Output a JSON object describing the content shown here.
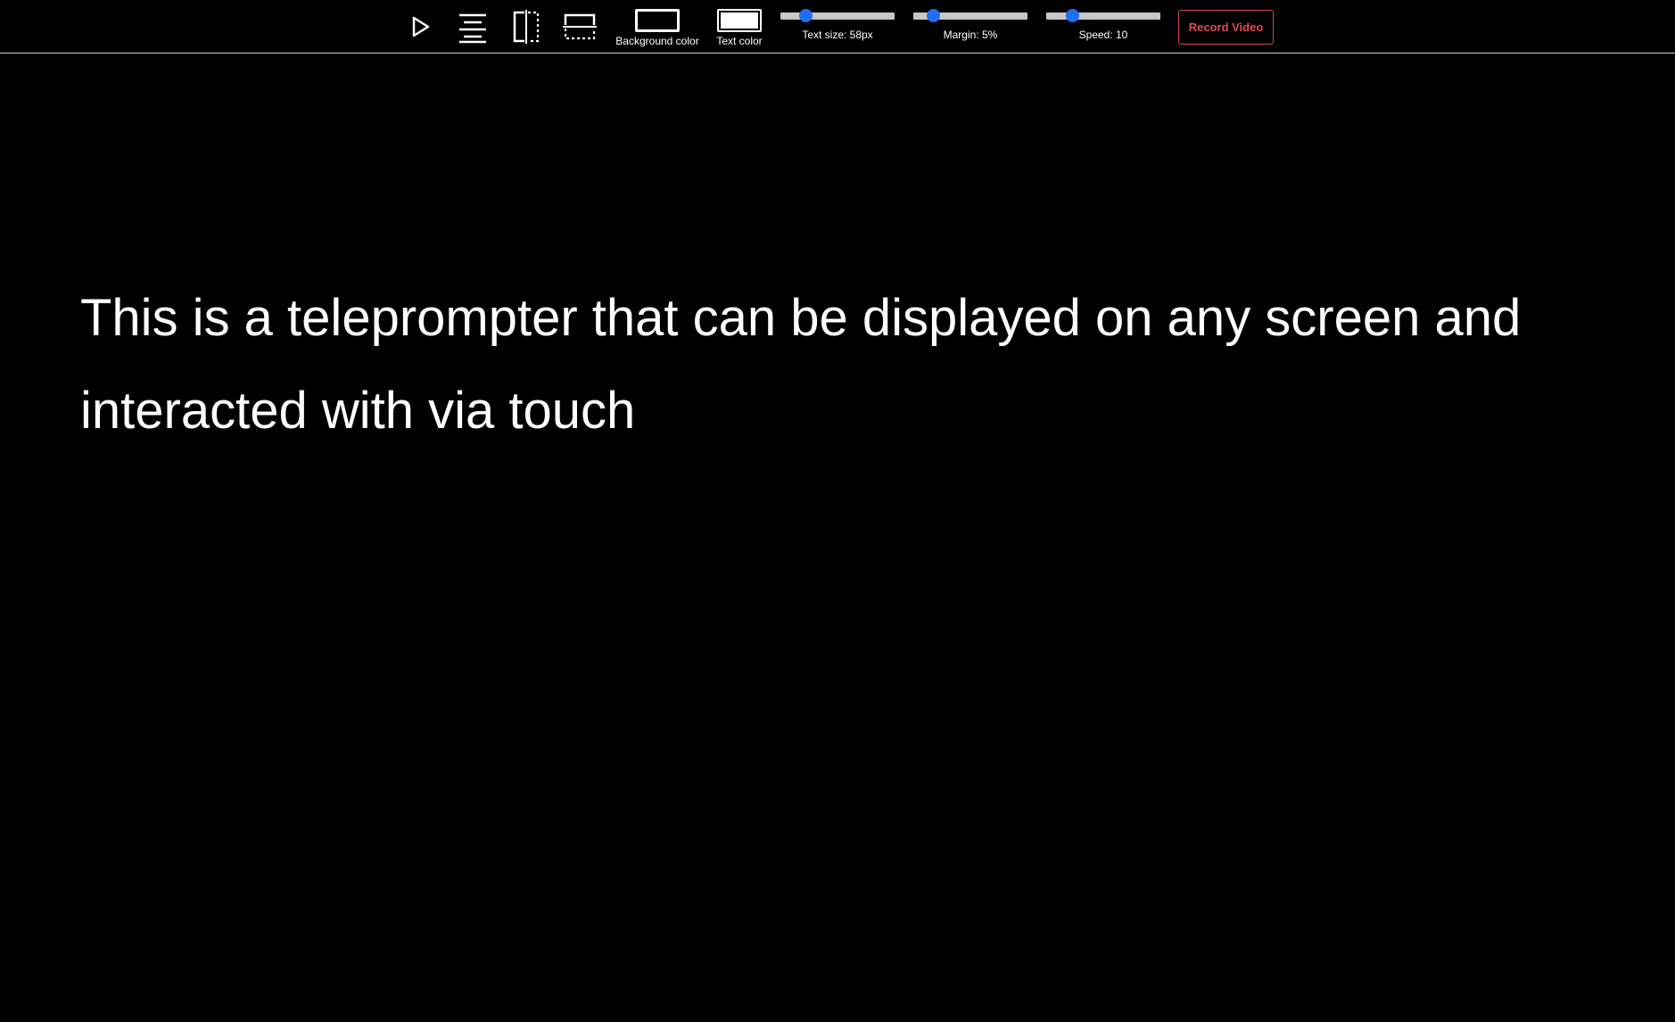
{
  "toolbar": {
    "icons": {
      "play": "play-icon",
      "align": "align-center-icon",
      "mirror_horizontal": "flip-horizontal-icon",
      "mirror_vertical": "flip-vertical-icon"
    },
    "background_color": {
      "label": "Background color",
      "value": "#000000"
    },
    "text_color": {
      "label": "Text color",
      "value": "#ffffff"
    },
    "text_size": {
      "label": "Text size: 58px",
      "value": 58,
      "fraction": 0.22
    },
    "margin": {
      "label": "Margin: 5%",
      "value": 5,
      "fraction": 0.17
    },
    "speed": {
      "label": "Speed: 10",
      "value": 10,
      "fraction": 0.23
    },
    "record_label": "Record Video"
  },
  "colors": {
    "accent": "#1f6ff4",
    "record": "#e04a52"
  },
  "script": {
    "text": "This is a teleprompter that can be displayed on any screen and interacted with via touch"
  }
}
